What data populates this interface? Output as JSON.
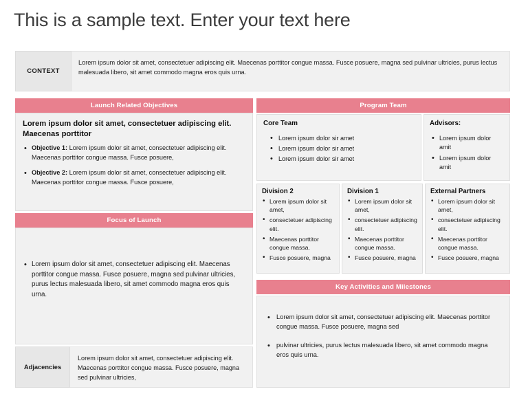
{
  "slide": {
    "title": "This is a sample text. Enter your text here",
    "accent_color": "#e8808e",
    "label_bg_color": "#e7e7e7",
    "panel_bg_color": "#f1f1f1"
  },
  "context": {
    "label": "CONTEXT",
    "text": "Lorem ipsum dolor sit amet, consectetuer adipiscing elit. Maecenas porttitor congue massa. Fusce posuere, magna sed pulvinar ultricies, purus lectus malesuada libero, sit amet commodo magna eros quis urna."
  },
  "launch_objectives": {
    "header": "Launch Related Objectives",
    "intro": "Lorem ipsum dolor sit amet, consectetuer adipiscing elit. Maecenas porttitor",
    "items": [
      {
        "label": "Objective 1:",
        "text": " Lorem ipsum dolor sit amet, consectetuer adipiscing elit. Maecenas porttitor congue massa. Fusce posuere,"
      },
      {
        "label": "Objective 2:",
        "text": " Lorem ipsum dolor sit amet, consectetuer adipiscing elit. Maecenas porttitor congue massa. Fusce posuere,"
      }
    ]
  },
  "focus_of_launch": {
    "header": "Focus of Launch",
    "items": [
      "Lorem ipsum dolor sit amet, consectetuer adipiscing elit. Maecenas porttitor congue massa. Fusce posuere, magna sed pulvinar ultricies, purus lectus malesuada libero, sit amet commodo magna eros quis urna."
    ]
  },
  "adjacencies": {
    "label": "Adjacencies",
    "text": "Lorem ipsum dolor sit amet, consectetuer adipiscing elit. Maecenas porttitor congue massa. Fusce posuere, magna sed pulvinar ultricies,"
  },
  "program_team": {
    "header": "Program Team",
    "core_team": {
      "title": "Core Team",
      "items": [
        "Lorem ipsum dolor sir amet",
        "Lorem ipsum dolor sir amet",
        "Lorem ipsum dolor sir amet"
      ]
    },
    "advisors": {
      "title": "Advisors:",
      "items": [
        "Lorem ipsum dolor amit",
        "Lorem ipsum dolor amit"
      ]
    },
    "division_2": {
      "title": "Division 2",
      "items": [
        "Lorem ipsum dolor sit amet,",
        "consectetuer adipiscing elit.",
        "Maecenas porttitor congue massa.",
        "Fusce posuere, magna"
      ]
    },
    "division_1": {
      "title": "Division 1",
      "items": [
        "Lorem ipsum dolor sit amet,",
        "consectetuer adipiscing elit.",
        "Maecenas porttitor congue massa.",
        "Fusce posuere, magna"
      ]
    },
    "external_partners": {
      "title": "External Partners",
      "items": [
        "Lorem ipsum dolor sit amet,",
        "consectetuer adipiscing elit.",
        "Maecenas porttitor congue massa.",
        "Fusce posuere, magna"
      ]
    }
  },
  "key_activities": {
    "header": "Key Activities and Milestones",
    "items": [
      "Lorem ipsum dolor sit amet, consectetuer adipiscing elit. Maecenas porttitor congue massa. Fusce posuere, magna sed",
      "pulvinar ultricies, purus lectus malesuada libero, sit amet commodo magna eros quis urna."
    ]
  }
}
